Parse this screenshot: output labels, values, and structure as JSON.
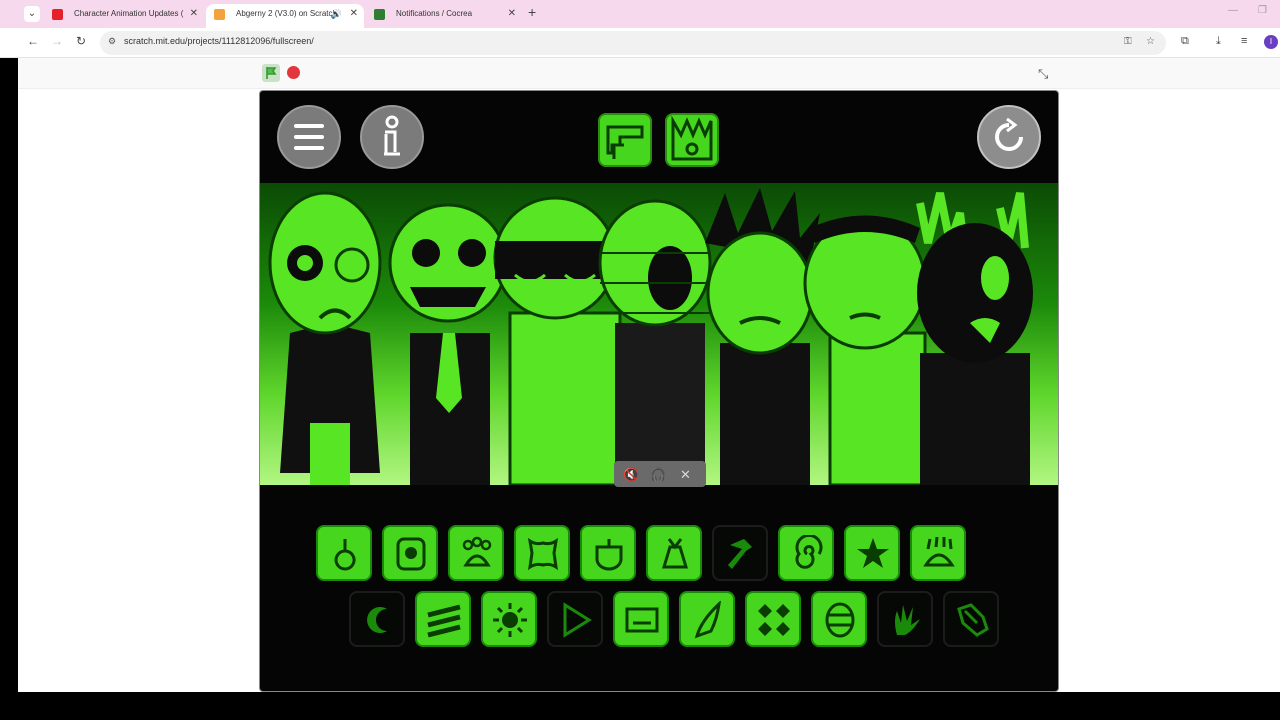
{
  "browser": {
    "tabs": [
      {
        "title": "Character Animation Updates (",
        "active": false,
        "favicon_color": "#e4212b"
      },
      {
        "title": "Abgerny 2 (V3.0) on Scratch",
        "active": true,
        "favicon_color": "#f3a33c"
      },
      {
        "title": "Notifications / Cocrea",
        "active": false,
        "favicon_color": "#2e7d32"
      }
    ],
    "new_tab": "+",
    "url": "scratch.mit.edu/projects/1112812096/fullscreen/"
  },
  "player": {
    "menu_icon": "hamburger-icon",
    "info_icon": "info-icon",
    "reset_icon": "reload-icon",
    "audio_controls": [
      "mute-icon",
      "headphones-icon",
      "close-icon"
    ]
  },
  "palette": {
    "on_color": "#46d61e",
    "off_color": "#060806",
    "row1": [
      {
        "name": "drop-icon",
        "on": true
      },
      {
        "name": "eye-icon",
        "on": true
      },
      {
        "name": "paw-icon",
        "on": true
      },
      {
        "name": "bone-icon",
        "on": true
      },
      {
        "name": "cup-icon",
        "on": true
      },
      {
        "name": "bag-icon",
        "on": true
      },
      {
        "name": "hammer-icon",
        "on": false
      },
      {
        "name": "spiral-icon",
        "on": true
      },
      {
        "name": "star-icon",
        "on": true
      },
      {
        "name": "claw-icon",
        "on": true
      }
    ],
    "row2": [
      {
        "name": "moon-icon",
        "on": false
      },
      {
        "name": "stripes-icon",
        "on": true
      },
      {
        "name": "sun-icon",
        "on": true
      },
      {
        "name": "play-icon",
        "on": false
      },
      {
        "name": "screen-icon",
        "on": true
      },
      {
        "name": "feather-icon",
        "on": true
      },
      {
        "name": "diamonds-icon",
        "on": true
      },
      {
        "name": "egg-icon",
        "on": true
      },
      {
        "name": "hand-icon",
        "on": false
      },
      {
        "name": "glove-icon",
        "on": false
      }
    ]
  }
}
